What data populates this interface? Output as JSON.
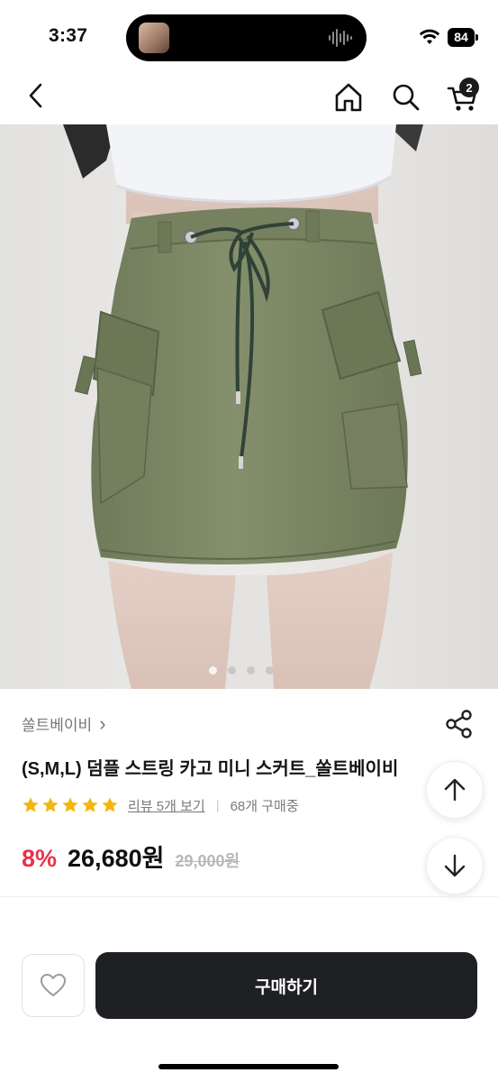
{
  "status": {
    "time": "3:37",
    "battery": "84"
  },
  "nav": {
    "back_icon": "chevron-left-icon",
    "home_icon": "home-icon",
    "search_icon": "search-icon",
    "cart_icon": "cart-icon",
    "cart_count": "2"
  },
  "gallery": {
    "image_subject": "olive green cargo mini skirt with drawstring",
    "dot_count": 4,
    "active_dot": 1
  },
  "product": {
    "brand": "쏠트베이비",
    "brand_chevron": "›",
    "title": "(S,M,L) 덤플 스트링 카고 미니 스커트_쏠트베이비",
    "rating_stars": 5,
    "review_link": "리뷰 5개 보기",
    "separator": "|",
    "buyers": "68개 구매중",
    "discount": "8%",
    "price": "26,680원",
    "original_price": "29,000원"
  },
  "actions": {
    "buy_label": "구매하기",
    "wish_icon": "heart-icon",
    "share_icon": "share-icon",
    "scroll_up_icon": "arrow-up-icon",
    "scroll_down_icon": "arrow-down-icon"
  },
  "colors": {
    "discount": "#e8334a",
    "star": "#f5b50b",
    "buy_button": "#1f2023",
    "skirt": "#7a8565"
  }
}
